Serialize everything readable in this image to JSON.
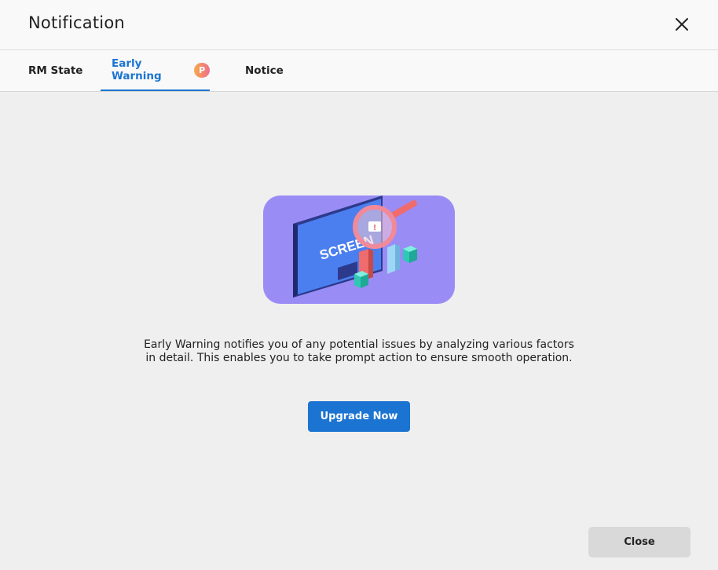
{
  "dialog": {
    "title": "Notification",
    "close_icon": "close-icon"
  },
  "tabs": [
    {
      "label": "RM State",
      "active": false
    },
    {
      "label": "Early Warning",
      "active": true,
      "badge": "P"
    },
    {
      "label": "Notice",
      "active": false
    }
  ],
  "illustration": {
    "screen_text": "SCREEN",
    "icon": "monitor-magnifier-illustration"
  },
  "description": "Early Warning notifies you of any potential issues by analyzing various factors in detail. This enables you to take prompt action to ensure smooth operation.",
  "buttons": {
    "upgrade_label": "Upgrade Now",
    "close_label": "Close"
  },
  "colors": {
    "accent": "#1b74d1",
    "illustration_bg": "#9a8cf5",
    "badge_gradient_start": "#f7a94a",
    "badge_gradient_end": "#ee6e8c"
  }
}
